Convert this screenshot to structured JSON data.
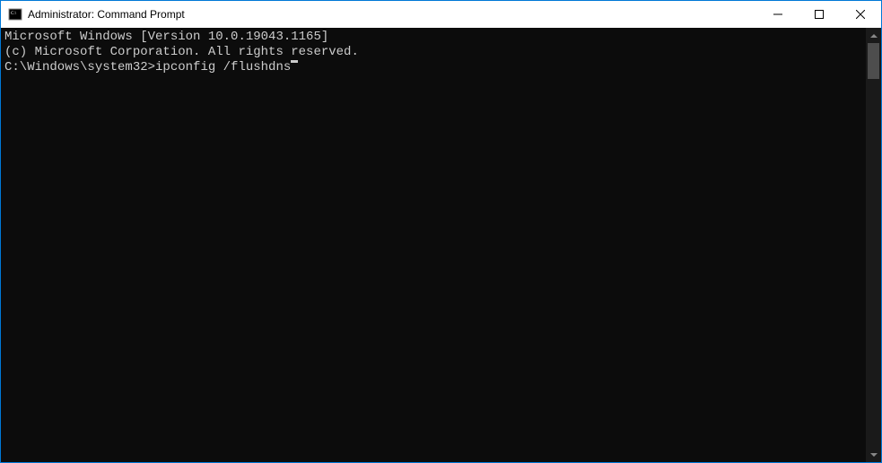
{
  "window": {
    "title": "Administrator: Command Prompt"
  },
  "terminal": {
    "line0": "Microsoft Windows [Version 10.0.19043.1165]",
    "line1": "(c) Microsoft Corporation. All rights reserved.",
    "blank": "",
    "prompt": "C:\\Windows\\system32>",
    "command": "ipconfig /flushdns"
  }
}
